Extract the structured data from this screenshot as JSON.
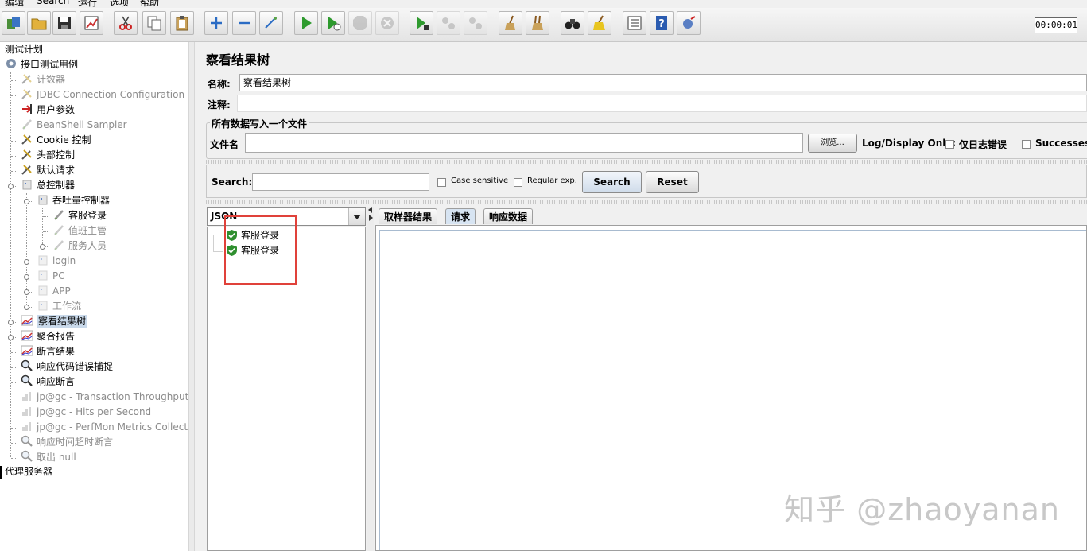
{
  "menu": [
    "编辑",
    "Search",
    "运行",
    "选项",
    "帮助"
  ],
  "timer": "00:00:01",
  "tree": {
    "root": "测试计划",
    "items": [
      {
        "label": "接口测试用例",
        "icon": "gear-icon",
        "dim": false
      },
      {
        "label": "计数器",
        "icon": "wrench-icon",
        "dim": true
      },
      {
        "label": "JDBC Connection Configuration",
        "icon": "wrench-icon",
        "dim": true
      },
      {
        "label": "用户参数",
        "icon": "preprocessor-icon",
        "dim": false
      },
      {
        "label": "BeanShell Sampler",
        "icon": "pen-icon",
        "dim": true
      },
      {
        "label": "Cookie 控制",
        "icon": "wrench-icon",
        "dim": false
      },
      {
        "label": "头部控制",
        "icon": "wrench-icon",
        "dim": false
      },
      {
        "label": "默认请求",
        "icon": "wrench-icon",
        "dim": false
      },
      {
        "label": "总控制器",
        "icon": "controller-icon",
        "dim": false
      },
      {
        "label": "吞吐量控制器",
        "icon": "controller-icon",
        "dim": false
      },
      {
        "label": "客服登录",
        "icon": "pen-icon",
        "dim": false
      },
      {
        "label": "值班主管",
        "icon": "pen-icon",
        "dim": true
      },
      {
        "label": "服务人员",
        "icon": "pen-icon",
        "dim": true
      },
      {
        "label": "login",
        "icon": "controller-icon",
        "dim": true
      },
      {
        "label": "PC",
        "icon": "controller-icon",
        "dim": true
      },
      {
        "label": "APP",
        "icon": "controller-icon",
        "dim": true
      },
      {
        "label": "工作流",
        "icon": "controller-icon",
        "dim": true
      },
      {
        "label": "察看结果树",
        "icon": "chart-icon",
        "dim": false
      },
      {
        "label": "聚合报告",
        "icon": "chart-icon",
        "dim": false
      },
      {
        "label": "断言结果",
        "icon": "chart-icon",
        "dim": false
      },
      {
        "label": "响应代码错误捕捉",
        "icon": "magnifier-icon",
        "dim": false
      },
      {
        "label": "响应断言",
        "icon": "magnifier-icon",
        "dim": false
      },
      {
        "label": "jp@gc - Transaction Throughput vs",
        "icon": "graph-icon",
        "dim": true
      },
      {
        "label": "jp@gc - Hits per Second",
        "icon": "graph-icon",
        "dim": true
      },
      {
        "label": "jp@gc - PerfMon Metrics Collector",
        "icon": "graph-icon",
        "dim": true
      },
      {
        "label": "响应时间超时断言",
        "icon": "magnifier-icon",
        "dim": true
      },
      {
        "label": "取出 null",
        "icon": "magnifier-icon",
        "dim": true
      }
    ],
    "proxy": "代理服务器"
  },
  "panel": {
    "title": "察看结果树",
    "name_label": "名称:",
    "name_value": "察看结果树",
    "comment_label": "注释:",
    "comment_value": "",
    "file_group": "所有数据写入一个文件",
    "file_label": "文件名",
    "file_value": "",
    "browse": "浏览...",
    "log_display": "Log/Display Only:",
    "errors_only": "仅日志错误",
    "successes": "Successes"
  },
  "search": {
    "label": "Search:",
    "value": "",
    "case_sensitive": "Case sensitive",
    "regular_exp": "Regular exp.",
    "search_btn": "Search",
    "reset_btn": "Reset"
  },
  "renderer": "JSON",
  "results": [
    "客服登录",
    "客服登录"
  ],
  "tabs": [
    "取样器结果",
    "请求",
    "响应数据"
  ],
  "watermark": "知乎 @zhaoyanan"
}
